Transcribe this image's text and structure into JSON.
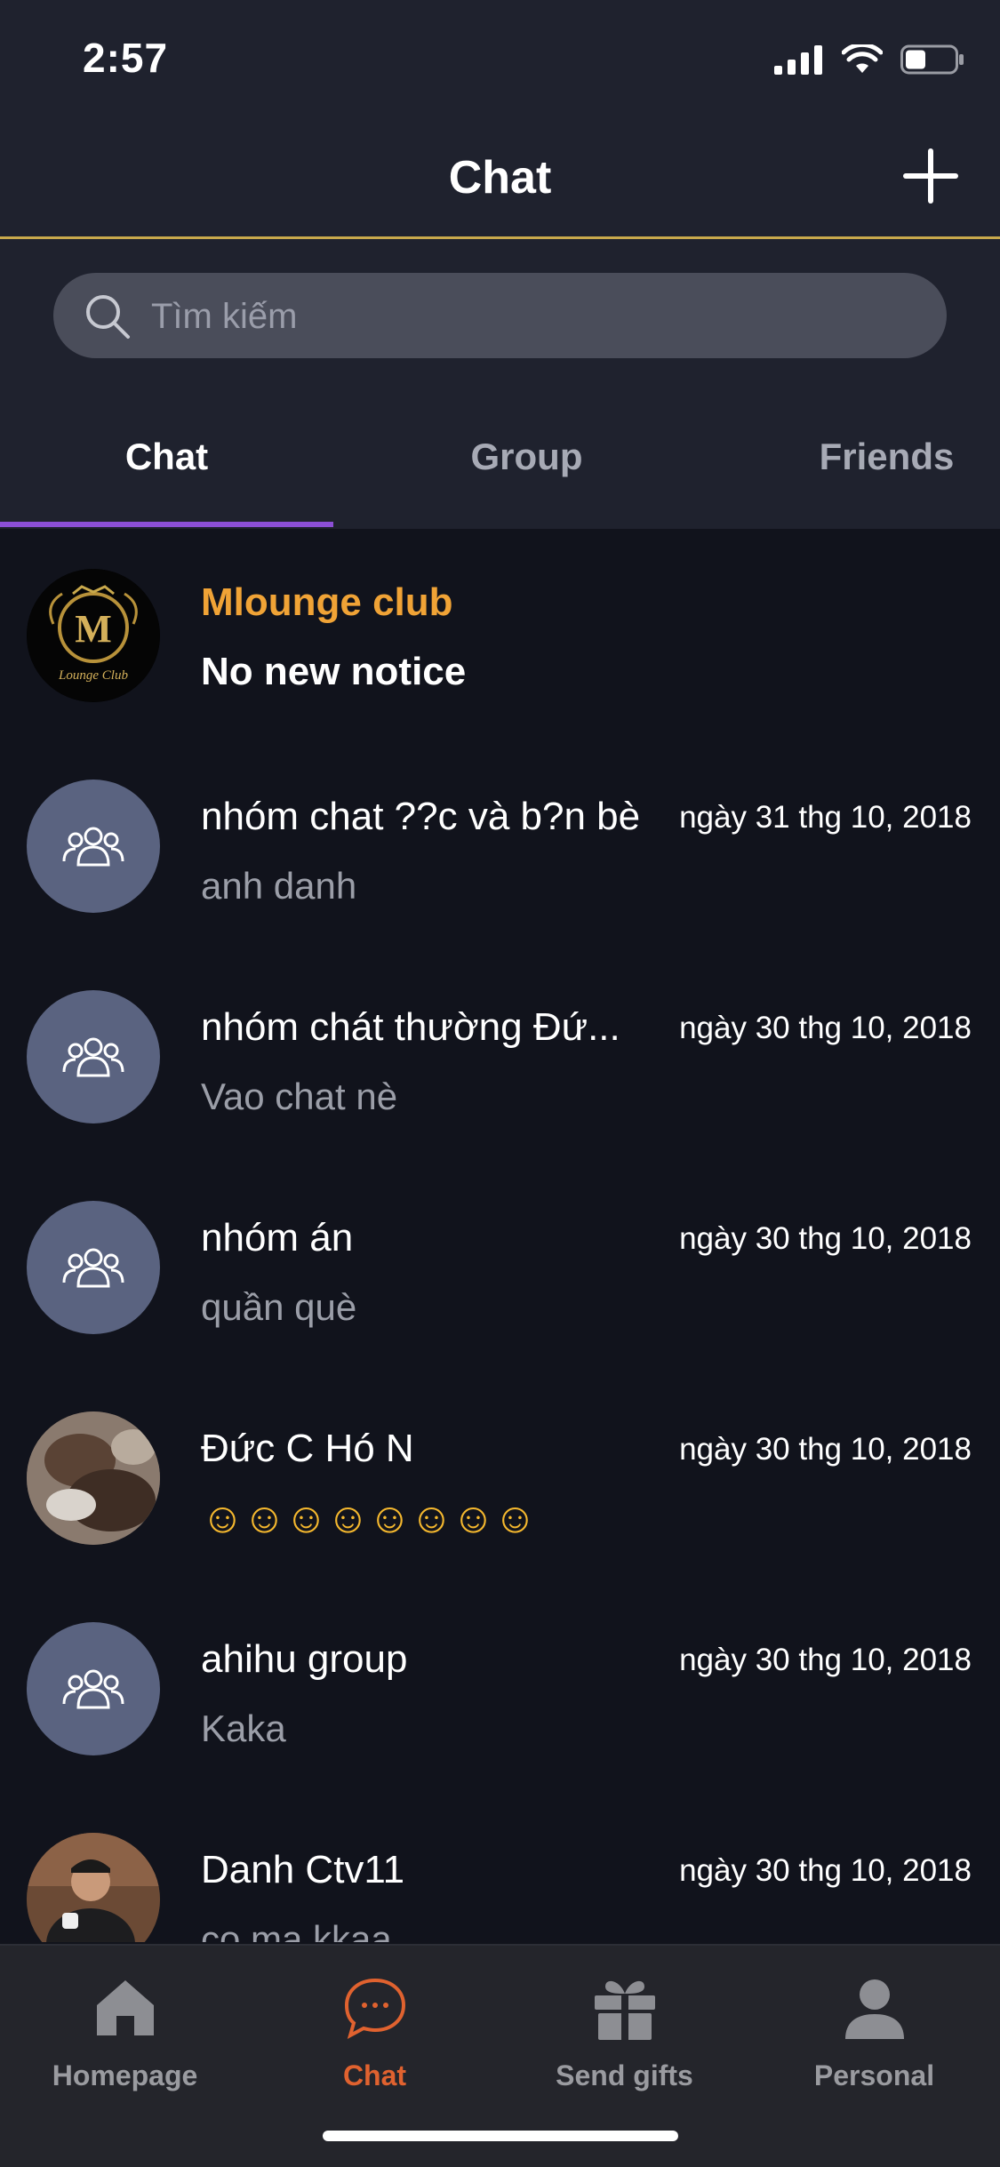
{
  "status_bar": {
    "time": "2:57"
  },
  "header": {
    "title": "Chat"
  },
  "search": {
    "placeholder": "Tìm kiếm"
  },
  "tabs": [
    {
      "label": "Chat",
      "active": true
    },
    {
      "label": "Group",
      "active": false
    },
    {
      "label": "Friends",
      "active": false
    }
  ],
  "notice": {
    "title": "Mlounge club",
    "subtitle": "No new notice",
    "logo_text": "M",
    "logo_caption": "Lounge Club"
  },
  "conversations": [
    {
      "title": "nhóm chat ??c và b?n bè",
      "message": "anh danh",
      "date": "ngày 31 thg 10, 2018",
      "avatar": "group-icon"
    },
    {
      "title": "nhóm chát thường Đứ...",
      "message": "Vao chat nè",
      "date": "ngày 30 thg 10, 2018",
      "avatar": "group-icon"
    },
    {
      "title": "nhóm án",
      "message": "quần què",
      "date": "ngày 30 thg 10, 2018",
      "avatar": "group-icon"
    },
    {
      "title": "Đức C Hó N",
      "message": "☺☺☺☺☺☺☺☺",
      "date": "ngày 30 thg 10, 2018",
      "avatar": "photo"
    },
    {
      "title": "ahihu group",
      "message": "Kaka",
      "date": "ngày 30 thg 10, 2018",
      "avatar": "group-icon"
    },
    {
      "title": "Danh Ctv11",
      "message": "co ma kkaa",
      "date": "ngày 30 thg 10, 2018",
      "avatar": "photo"
    }
  ],
  "bottom_nav": [
    {
      "label": "Homepage",
      "icon": "home-icon",
      "active": false
    },
    {
      "label": "Chat",
      "icon": "chat-bubble-icon",
      "active": true
    },
    {
      "label": "Send gifts",
      "icon": "gift-icon",
      "active": false
    },
    {
      "label": "Personal",
      "icon": "person-icon",
      "active": false
    }
  ],
  "colors": {
    "accent": "#e0622f",
    "tab_indicator": "#8c4fd6",
    "notice_title": "#f0a336",
    "header_border": "#c9a94c"
  }
}
